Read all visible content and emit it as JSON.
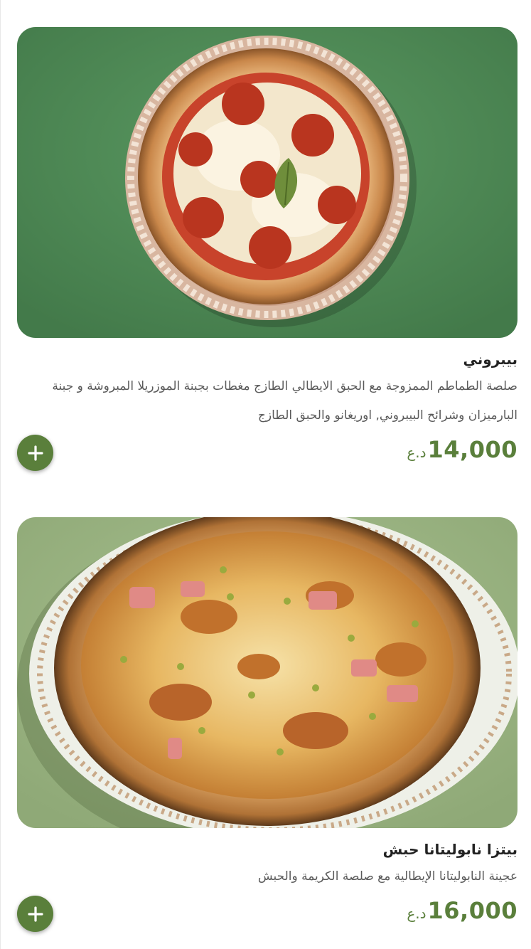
{
  "products": [
    {
      "name": "بيبروني",
      "description_line1": "صلصة الطماطم الممزوجة مع الحبق الايطالي الطازج مغطات بجبنة الموزريلا المبروشة و جبنة",
      "description_line2": "البارميزان وشرائح البيبروني, اوريغانو والحبق الطازج",
      "price": "14,000",
      "currency": "د.ع",
      "image_icon": "pepperoni-pizza-image",
      "add_icon": "plus-icon"
    },
    {
      "name": "بيتزا نابوليتانا حبش",
      "description_line1": "عجينة النابوليتانا الإيطالية مع صلصة الكريمة والحبش",
      "price": "16,000",
      "currency": "د.ع",
      "image_icon": "napoletana-turkey-pizza-image",
      "add_icon": "plus-icon"
    }
  ],
  "colors": {
    "accent": "#5a7f3b",
    "title": "#222222",
    "description": "#5a5a5a",
    "photo1_bg": "#4f8a56",
    "photo2_bg": "#9cb584"
  }
}
